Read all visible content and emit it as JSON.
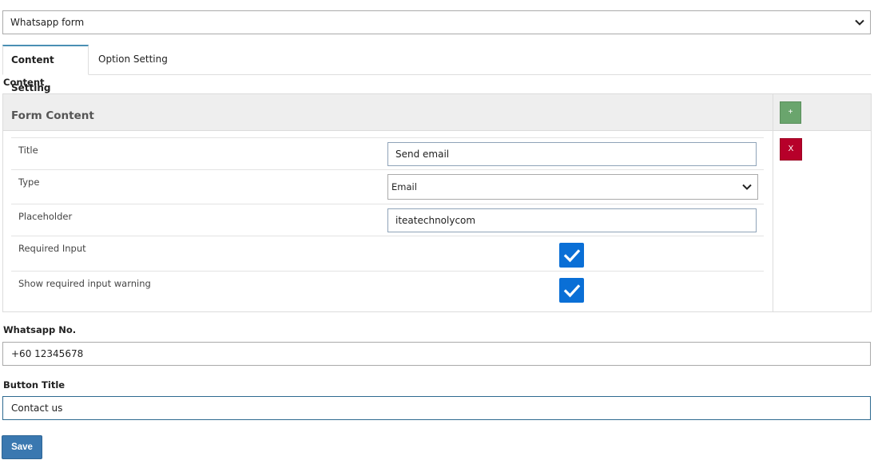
{
  "form_selector": {
    "value": "Whatsapp form"
  },
  "tabs": [
    {
      "label": "Content Setting",
      "active": true
    },
    {
      "label": "Option Setting",
      "active": false
    }
  ],
  "content_section": {
    "label": "Content"
  },
  "form_content": {
    "header": "Form Content",
    "add_button": "+",
    "delete_button": "X",
    "rows": {
      "title": {
        "label": "Title",
        "value": "Send email"
      },
      "type": {
        "label": "Type",
        "value": "Email"
      },
      "placeholder": {
        "label": "Placeholder",
        "value": "iteatechnolycom"
      },
      "required_input": {
        "label": "Required Input",
        "checked": true
      },
      "show_warning": {
        "label": "Show required input warning",
        "checked": true
      }
    }
  },
  "whatsapp": {
    "label": "Whatsapp No.",
    "value": "+60 12345678"
  },
  "button_title": {
    "label": "Button Title",
    "value": "Contact us"
  },
  "save_button": {
    "label": "Save"
  },
  "colors": {
    "tab_active_border": "#4a8fb4",
    "add_button": "#6aa56d",
    "delete_button": "#b7002a",
    "checkbox": "#0a6fd6",
    "save_button": "#3a78b0"
  },
  "icons": {
    "select_arrow": "chevron-down-icon",
    "checkbox_mark": "check-icon"
  }
}
